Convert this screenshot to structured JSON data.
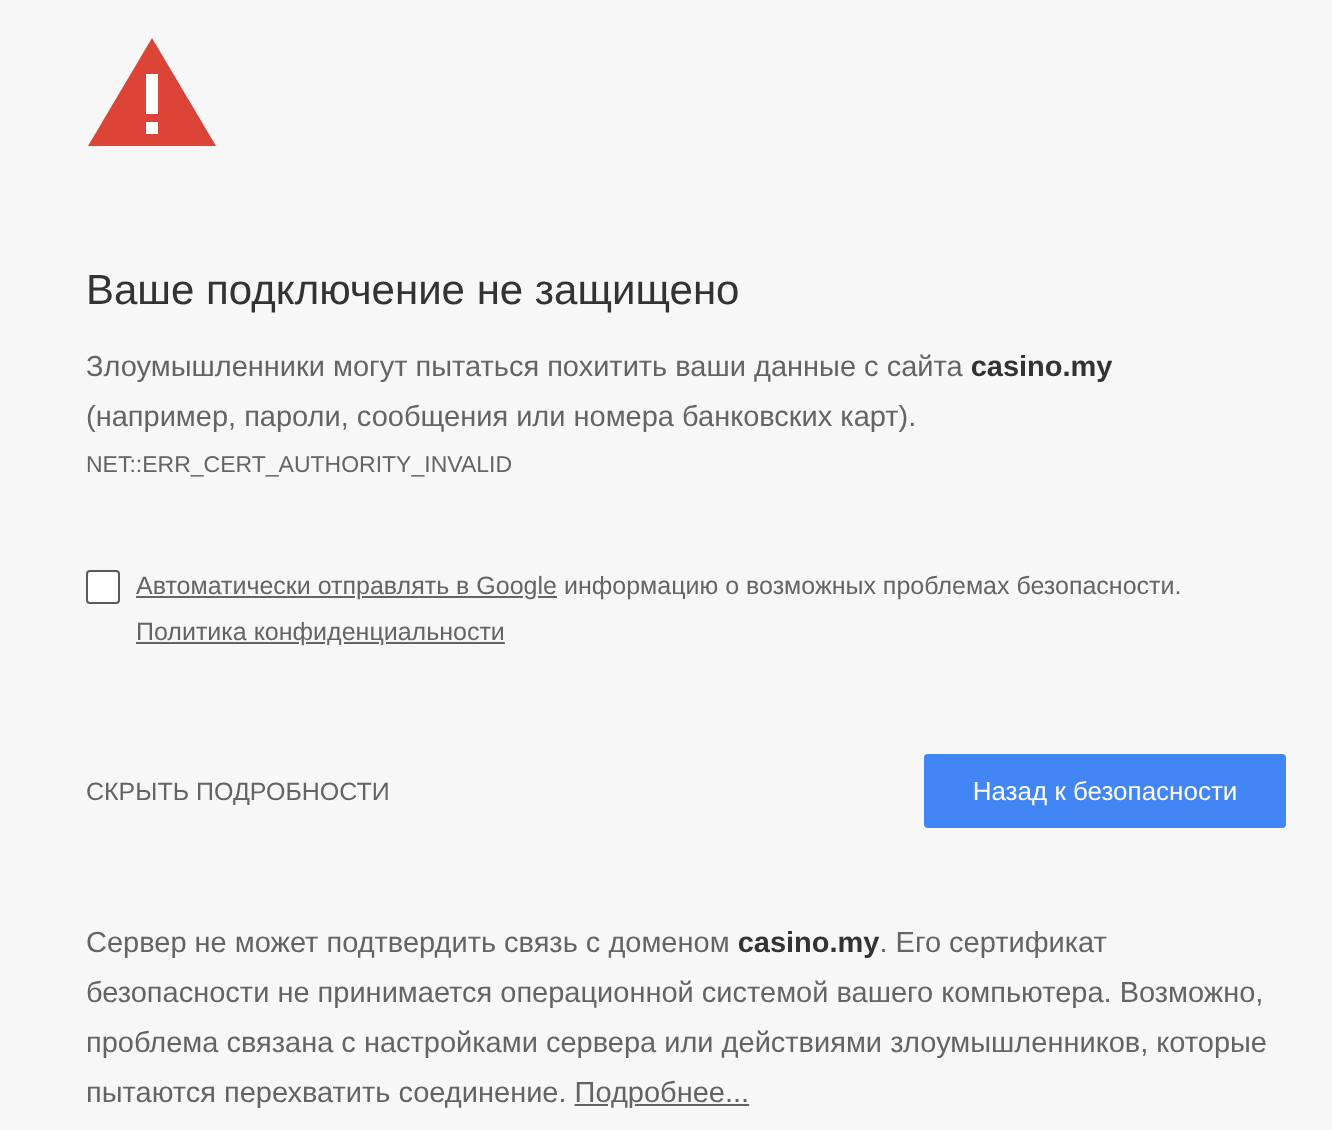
{
  "title": "Ваше подключение не защищено",
  "description": "Злоумышленники могут пытаться похитить ваши данные с сайта **casino.my** (например, пароли, сообщения или номера банковских карт).",
  "error_code": "NET::ERR_CERT_AUTHORITY_INVALID",
  "report": {
    "checked": false,
    "link": "Автоматически отправлять в Google",
    "text": "информацию о возможных проблемах безопасности.",
    "privacy_link": "Политика конфиденциальности"
  },
  "details_toggle": "СКРЫТЬ ПОДРОБНОСТИ",
  "back_button": "Назад к безопасности",
  "details": {
    "text": "Сервер не может подтвердить связь с доменом **casino.my**. Его сертификат безопасности не принимается операционной системой вашего компьютера. Возможно, проблема связана с настройками сервера или действиями злоумышленников, которые пытаются перехватить соединение.",
    "link": "Подробнее..."
  }
}
